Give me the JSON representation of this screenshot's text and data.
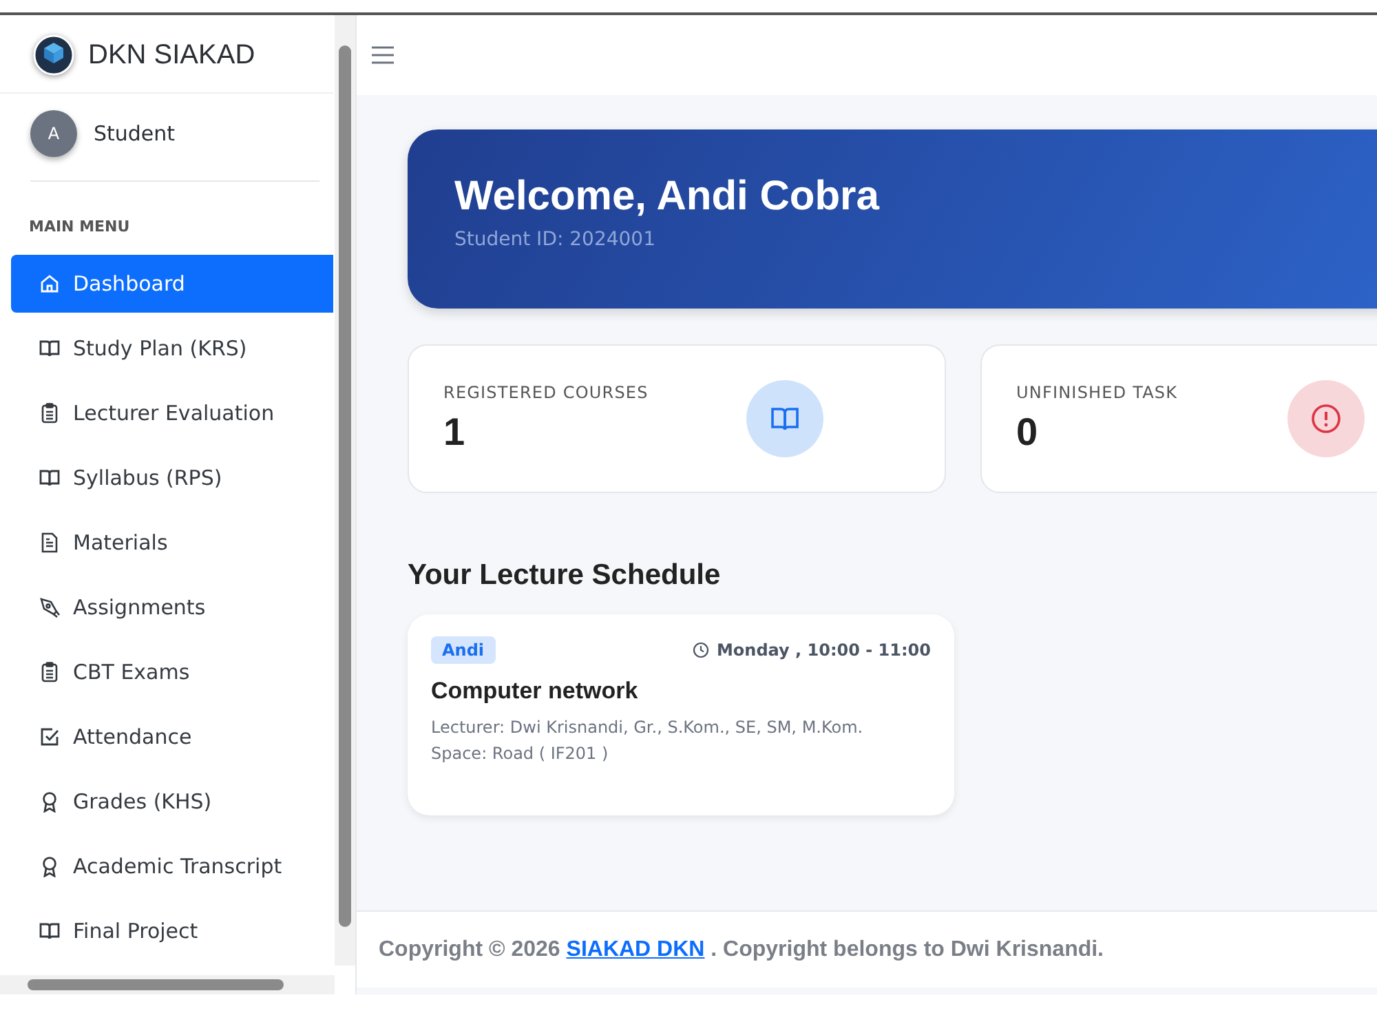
{
  "brand": {
    "name": "DKN SIAKAD"
  },
  "user": {
    "avatar_letter": "A",
    "role": "Student"
  },
  "menu_heading": "MAIN MENU",
  "menu": [
    {
      "label": "Dashboard",
      "kind": "home",
      "selected": true
    },
    {
      "label": "Study Plan (KRS)",
      "kind": "book",
      "selected": false
    },
    {
      "label": "Lecturer Evaluation",
      "kind": "clipboard",
      "selected": false
    },
    {
      "label": "Syllabus (RPS)",
      "kind": "book",
      "selected": false
    },
    {
      "label": "Materials",
      "kind": "document",
      "selected": false
    },
    {
      "label": "Assignments",
      "kind": "pen",
      "selected": false
    },
    {
      "label": "CBT Exams",
      "kind": "clipboard",
      "selected": false
    },
    {
      "label": "Attendance",
      "kind": "checkbox",
      "selected": false
    },
    {
      "label": "Grades (KHS)",
      "kind": "award",
      "selected": false
    },
    {
      "label": "Academic Transcript",
      "kind": "award",
      "selected": false
    },
    {
      "label": "Final Project",
      "kind": "book",
      "selected": false
    }
  ],
  "welcome": {
    "title": "Welcome, Andi Cobra",
    "student_id": "Student ID: 2024001"
  },
  "stats": [
    {
      "label": "REGISTERED COURSES",
      "value": "1",
      "kind": "info"
    },
    {
      "label": "UNFINISHED TASK",
      "value": "0",
      "kind": "alert"
    }
  ],
  "schedule_heading": "Your Lecture Schedule",
  "schedule": [
    {
      "tag": "Andi",
      "time": "Monday , 10:00 - 11:00",
      "course": "Computer network",
      "lecturer": "Lecturer: Dwi Krisnandi, Gr., S.Kom., SE, SM, M.Kom.",
      "space": "Space: Road ( IF201 )"
    }
  ],
  "footer": {
    "prefix": "Copyright © 2026",
    "link": "SIAKAD DKN",
    "suffix": ". Copyright belongs to Dwi Krisnandi."
  }
}
